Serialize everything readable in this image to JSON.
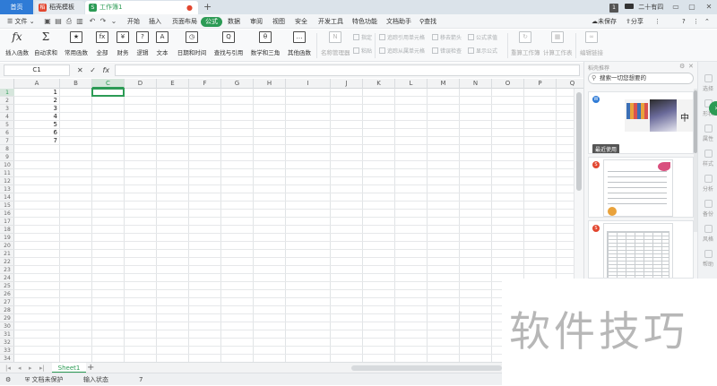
{
  "titlebar": {
    "home_tab": "首页",
    "tabs": [
      {
        "label": "稻壳模板",
        "icon": "daoke-icon"
      },
      {
        "label": "工作簿1",
        "icon": "sheet-icon"
      }
    ],
    "page_count": "1",
    "user": "二十有四",
    "window_controls": [
      "minimize",
      "maximize",
      "close"
    ]
  },
  "menubar": {
    "file_label": "文件",
    "items": [
      "开始",
      "插入",
      "页面布局",
      "公式",
      "数据",
      "审阅",
      "视图",
      "安全",
      "开发工具",
      "特色功能",
      "文档助手"
    ],
    "active_item": "公式",
    "search_label": "查找",
    "sync_label": "未保存",
    "share_label": "分享",
    "help_label": "?"
  },
  "ribbon": {
    "buttons": [
      {
        "label": "插入函数",
        "icon": "fx"
      },
      {
        "label": "自动求和",
        "icon": "Σ"
      },
      {
        "label": "常用函数",
        "icon": "★"
      },
      {
        "label": "全部",
        "icon": "fx"
      },
      {
        "label": "财务",
        "icon": "¥"
      },
      {
        "label": "逻辑",
        "icon": "?"
      },
      {
        "label": "文本",
        "icon": "A"
      },
      {
        "label": "日期和时间",
        "icon": "◷"
      },
      {
        "label": "查找与引用",
        "icon": "Q"
      },
      {
        "label": "数学和三角",
        "icon": "θ"
      },
      {
        "label": "其他函数",
        "icon": "…"
      },
      {
        "label": "名称管理器",
        "icon": "N"
      },
      {
        "label": "重算工作簿",
        "icon": "↻"
      },
      {
        "label": "计算工作表",
        "icon": "▦"
      },
      {
        "label": "编辑链接",
        "icon": "∞"
      }
    ],
    "small_buttons": [
      "指定",
      "粘贴",
      "追踪引用单元格",
      "追踪从属单元格",
      "移去箭头",
      "错误检查",
      "公式求值",
      "显示公式"
    ]
  },
  "formula_bar": {
    "cell_ref": "C1",
    "fx_label": "fx",
    "value": ""
  },
  "grid": {
    "columns": [
      "A",
      "B",
      "C",
      "D",
      "E",
      "F",
      "G",
      "H",
      "I",
      "J",
      "K",
      "L",
      "M",
      "N",
      "O",
      "P",
      "Q"
    ],
    "row_count": 34,
    "selected_column": "C",
    "selected_row": "1",
    "column_a_values": [
      "1",
      "2",
      "3",
      "4",
      "5",
      "6",
      "7"
    ]
  },
  "sheetbar": {
    "sheet_name": "Sheet1",
    "add_label": "+"
  },
  "statusbar": {
    "protect_label": "文档未保护",
    "input_state": "输入状态",
    "count_value": "7"
  },
  "panel": {
    "title": "稻壳推荐",
    "search_placeholder": "搜索一切您想要的",
    "recent_label": "最近使用",
    "card_text": "中"
  },
  "sidebar": {
    "items": [
      "选择",
      "形状",
      "属性",
      "样式",
      "分析",
      "备份",
      "风格",
      "帮助"
    ]
  },
  "watermark": "软件技巧",
  "colors": {
    "accent_green": "#2c9b55",
    "home_blue": "#2f7bd6",
    "tab_red": "#e2462f"
  }
}
